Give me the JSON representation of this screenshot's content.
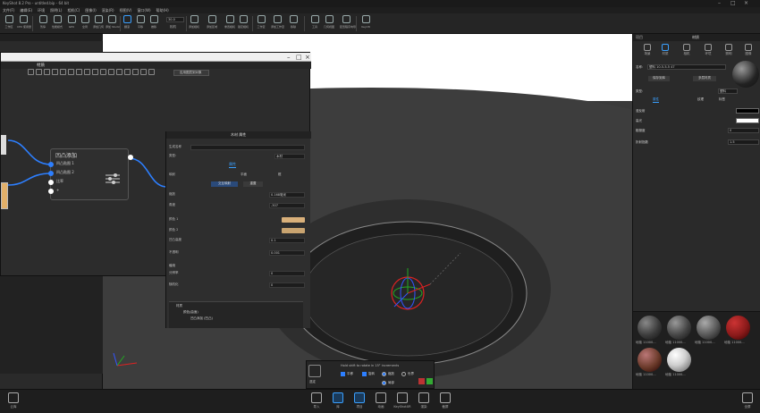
{
  "window": {
    "title": "KeyShot 8.2 Pro - untitled.bip - 64 bit"
  },
  "menu": [
    "文件(F)",
    "编辑(E)",
    "环境",
    "照明(L)",
    "相机(C)",
    "图像(I)",
    "渲染(R)",
    "视图(V)",
    "窗口(W)",
    "帮助(H)"
  ],
  "toolbar": [
    {
      "label": "工作区"
    },
    {
      "label": "CPU 使用量"
    },
    {
      "label": "暂停"
    },
    {
      "label": "性能模式"
    },
    {
      "label": "GPU"
    },
    {
      "label": "全局"
    },
    {
      "label": "添加几何"
    },
    {
      "label": "添加 Studio"
    },
    {
      "label": "区域"
    },
    {
      "label": "翻滚"
    },
    {
      "label": "平移"
    },
    {
      "label": "推移"
    },
    {
      "label": "视角"
    },
    {
      "label": "添加相机"
    },
    {
      "label": "添加区域"
    },
    {
      "label": "重置相机"
    },
    {
      "label": "锁定相机"
    },
    {
      "label": "工作室"
    },
    {
      "label": "添加工作室"
    },
    {
      "label": "移除"
    },
    {
      "label": "工具"
    },
    {
      "label": "几何视图"
    },
    {
      "label": "配置程序向导"
    },
    {
      "label": "KeyVR"
    }
  ],
  "toolbar_values": {
    "fov": "30.0",
    "camera_label": "相机"
  },
  "node_editor": {
    "title": "材质",
    "node": {
      "title": "凹凸添加",
      "ports": [
        "凹凸贴图 1",
        "凹凸贴图 2",
        "比率",
        "+"
      ]
    }
  },
  "float_window": {
    "title_button": "应用图层到对象",
    "property_title": "木材 属性",
    "tabs": [
      "属性"
    ],
    "rows": [
      {
        "key": "生成名称",
        "value": ""
      },
      {
        "key": "类型:",
        "value": "木材"
      },
      {
        "key": "映射",
        "value": ""
      },
      {
        "key": "缩放",
        "value": "0.168毫米"
      },
      {
        "key": "角度",
        "value": "-307"
      },
      {
        "key": "颜色 1",
        "value": ""
      },
      {
        "key": "颜色 2",
        "value": ""
      },
      {
        "key": "凹凸高度",
        "value": "0.1"
      },
      {
        "key": "不透明",
        "value": "0.001"
      }
    ],
    "mapping_buttons": [
      "平面",
      "框",
      "交互映射",
      "重置"
    ],
    "section_label": "缠绕",
    "section_rows": [
      {
        "key": "分辨率",
        "value": "0"
      },
      {
        "key": "随机化",
        "value": "0"
      }
    ],
    "tree": [
      "材质",
      "颜色(曲面)",
      "凹凸添加 (凹凸)"
    ]
  },
  "right_panel": {
    "title": "材质",
    "tabs": [
      "项目",
      "场景",
      "材质",
      "相机",
      "环境",
      "照明",
      "图像"
    ],
    "name_label": "名称:",
    "name_value": "塑料 10-5-5-5 47",
    "buttons": [
      "保存到库",
      "多层材质"
    ],
    "type_label": "类型:",
    "type_value": "塑料",
    "subtabs": [
      "属性",
      "纹理",
      "标签"
    ],
    "rows": [
      {
        "key": "漫反射",
        "value": ""
      },
      {
        "key": "高光",
        "value": ""
      },
      {
        "key": "粗糙度",
        "value": "0"
      },
      {
        "key": "折射指数",
        "value": "1.5"
      }
    ],
    "balls": [
      {
        "name": "地毯 11000...",
        "color": "#3b3b3b"
      },
      {
        "name": "地毯 11000...",
        "color": "#444444"
      },
      {
        "name": "地毯 11000...",
        "color": "#555555"
      },
      {
        "name": "地毯 11000...",
        "color": "#8a1a1a"
      },
      {
        "name": "地毯 11000...",
        "color": "#6a3a2a"
      },
      {
        "name": "地毯 11000...",
        "color": "#cfcfcf"
      }
    ]
  },
  "gizmo": {
    "hint": "Hold shift to rotate in 15° increments",
    "mode_label": "选定",
    "options": [
      "平移",
      "旋转",
      "缩放",
      "世界",
      "局部"
    ]
  },
  "bottom_bar": {
    "left": "云库",
    "items": [
      "导入",
      "库",
      "项目",
      "动画",
      "KeyShotXR",
      "渲染",
      "截屏"
    ],
    "right": "全屏"
  },
  "colors": {
    "accent": "#3aa0ff",
    "swatch1": "#d9b07a",
    "swatch2": "#c9a470"
  }
}
